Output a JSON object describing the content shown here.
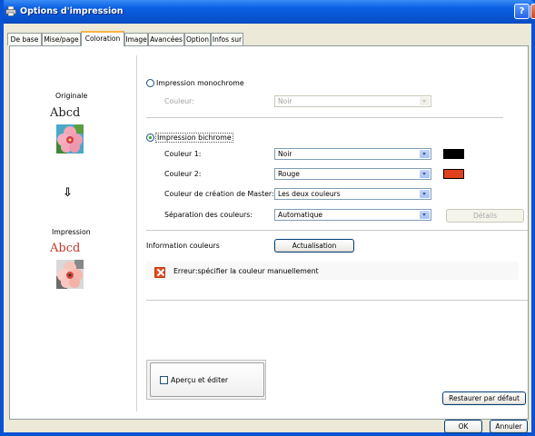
{
  "window": {
    "title": "Options d'impression",
    "help_glyph": "?",
    "close_glyph": "✕"
  },
  "tabs": [
    {
      "label": "De base"
    },
    {
      "label": "Mise/page"
    },
    {
      "label": "Coloration"
    },
    {
      "label": "Image"
    },
    {
      "label": "Avancées"
    },
    {
      "label": "Option"
    },
    {
      "label": "Infos sur"
    }
  ],
  "active_tab": "Coloration",
  "left_preview": {
    "original_label": "Originale",
    "sample_text": "Abcd",
    "arrow_glyph": "⇩",
    "print_label": "Impression"
  },
  "mono": {
    "label": "Impression monochrome",
    "color_label": "Couleur:",
    "color_value": "Noir"
  },
  "bichrome": {
    "label": "Impression bichrome",
    "color1_label": "Couleur 1:",
    "color1_value": "Noir",
    "color1_swatch": "#000000",
    "color2_label": "Couleur 2:",
    "color2_value": "Rouge",
    "color2_swatch": "#e2401c",
    "master_label": "Couleur de création de Master:",
    "master_value": "Les deux couleurs",
    "separation_label": "Séparation des couleurs:",
    "separation_value": "Automatique",
    "details_button": "Détails"
  },
  "color_info": {
    "label": "Information couleurs",
    "refresh_button": "Actualisation",
    "error_text": "Erreur:spécifier la couleur manuellement"
  },
  "preview_edit": {
    "label": "Aperçu et éditer"
  },
  "restore_button": "Restaurer par défaut",
  "footer": {
    "ok": "OK",
    "cancel": "Annuler"
  },
  "colors": {
    "title_bar": "#0a5fe3",
    "dialog_bg": "#ece9d8",
    "active_tab_accent": "#f9b548",
    "error_icon": "#e24b1d"
  }
}
